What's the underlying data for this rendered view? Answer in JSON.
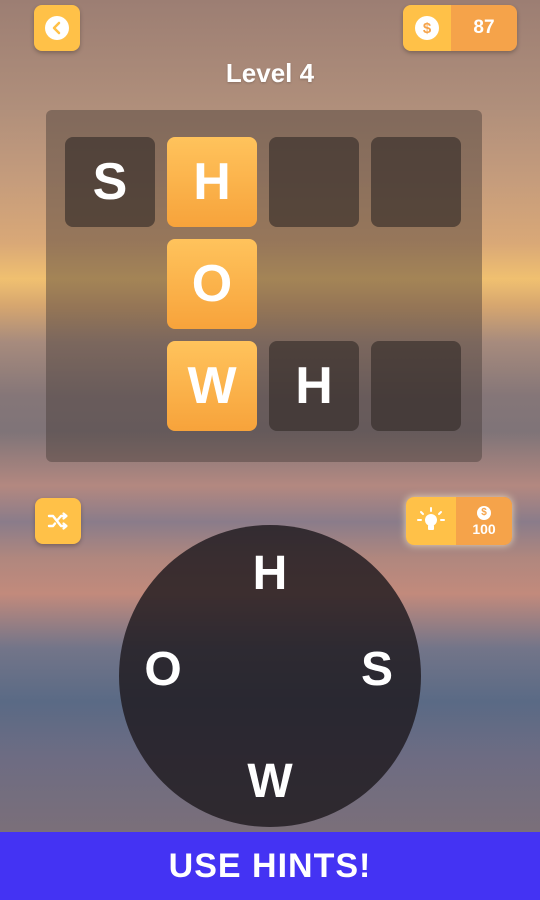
{
  "header": {
    "coins": "87",
    "coin_symbol": "$",
    "level_title": "Level 4"
  },
  "board": {
    "tiles": [
      {
        "letter": "S",
        "state": "dark"
      },
      {
        "letter": "H",
        "state": "highlight"
      },
      {
        "letter": "",
        "state": "dark"
      },
      {
        "letter": "",
        "state": "dark"
      },
      {
        "letter": "O",
        "state": "highlight"
      },
      {
        "letter": "W",
        "state": "highlight"
      },
      {
        "letter": "H",
        "state": "dark"
      },
      {
        "letter": "",
        "state": "dark"
      }
    ]
  },
  "hint": {
    "cost": "100",
    "coin_symbol": "$"
  },
  "wheel": {
    "letters": [
      "H",
      "O",
      "S",
      "W"
    ]
  },
  "banner": {
    "text": "USE HINTS!"
  },
  "colors": {
    "accent": "#ffc148",
    "accent_dark": "#f5a34a",
    "banner": "#4433f3"
  }
}
